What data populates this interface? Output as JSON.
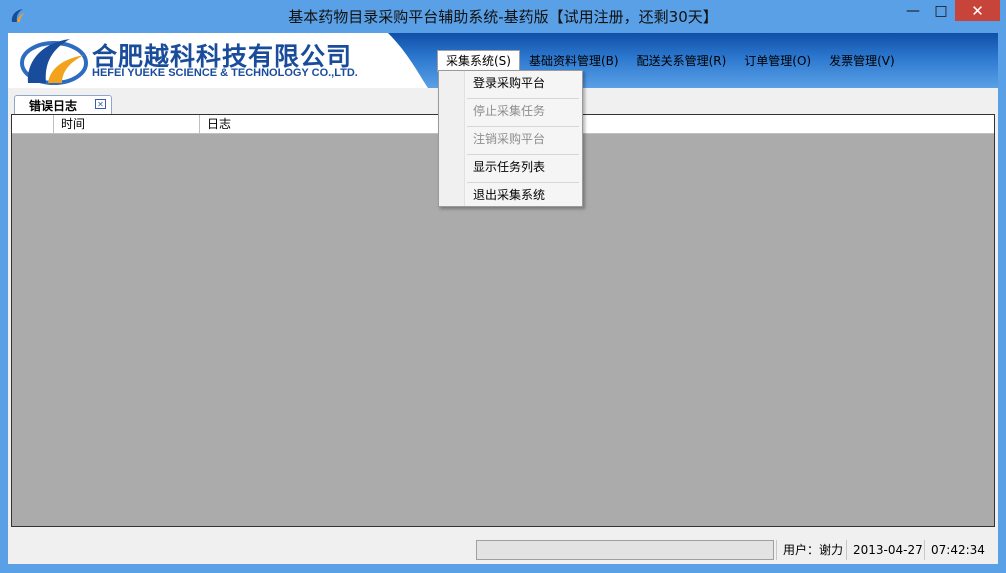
{
  "window": {
    "title": "基本药物目录采购平台辅助系统-基药版【试用注册，还剩30天】",
    "minimize_glyph": "—",
    "maximize_glyph": "□",
    "close_glyph": "✕"
  },
  "banner": {
    "company_cn": "合肥越科科技有限公司",
    "company_en": "HEFEI YUEKE SCIENCE & TECHNOLOGY CO.,LTD."
  },
  "menu": [
    {
      "label": "采集系统(S)"
    },
    {
      "label": "基础资料管理(B)"
    },
    {
      "label": "配送关系管理(R)"
    },
    {
      "label": "订单管理(O)"
    },
    {
      "label": "发票管理(V)"
    }
  ],
  "dropdown": [
    {
      "label": "登录采购平台",
      "enabled": true
    },
    {
      "label": "停止采集任务",
      "enabled": false
    },
    {
      "label": "注销采购平台",
      "enabled": false
    },
    {
      "label": "显示任务列表",
      "enabled": true
    },
    {
      "label": "退出采集系统",
      "enabled": true
    }
  ],
  "tabs": [
    {
      "label": "错误日志"
    }
  ],
  "grid": {
    "columns": [
      "",
      "时间",
      "日志"
    ]
  },
  "status": {
    "user": "用户：谢力",
    "date": "2013-04-27",
    "time": "07:42:34"
  },
  "colors": {
    "frame": "#5aa0e6",
    "close_button": "#c7443a",
    "brand_blue": "#1a4c9c",
    "grid_background": "#ababab"
  },
  "icons": {
    "app": "yueke-logo-icon",
    "tab_close": "close-icon"
  }
}
